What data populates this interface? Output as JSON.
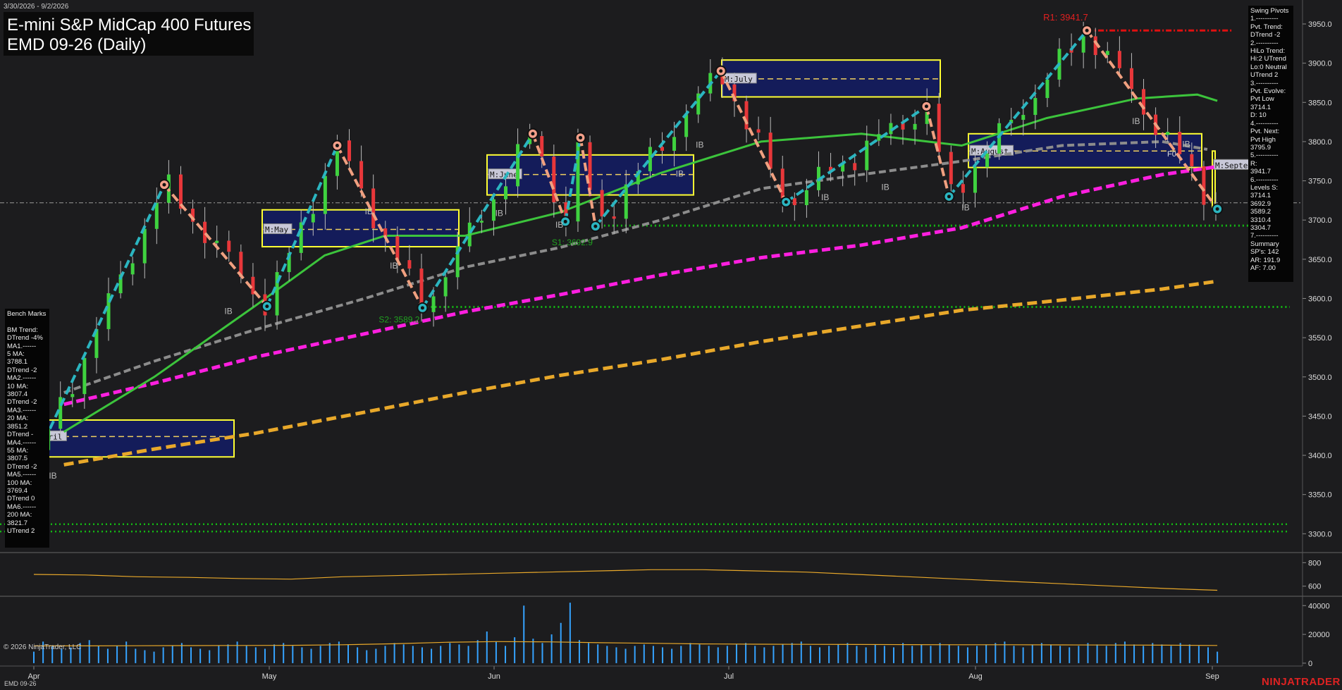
{
  "header": {
    "date_range": "3/30/2026 - 9/2/2026",
    "title": "E-mini S&P MidCap 400 Futures",
    "subtitle": "EMD 09-26 (Daily)"
  },
  "swing_pivots_panel": [
    "Swing Pivots",
    "1.----------",
    "Pvt. Trend:",
    "DTrend -2",
    "2.----------",
    "HiLo Trend:",
    "Hi:2 UTrend",
    "Lo:0 Neutral",
    "UTrend 2",
    "3.----------",
    "Pvt. Evolve:",
    "Pvt Low",
    "3714.1",
    "D: 10",
    "4.----------",
    "Pvt. Next:",
    "Pvt High",
    "3795.9",
    "5.----------",
    "R:",
    "3941.7",
    "6.----------",
    "Levels S:",
    "3714.1",
    "3692.9",
    "3589.2",
    "3310.4",
    "3304.7",
    "7.----------",
    "Summary",
    "SP's: 142",
    "AR: 191.9",
    "AF: 7.00"
  ],
  "bench_marks_panel": [
    "Bench Marks",
    "",
    "BM Trend:",
    "DTrend -4%",
    "MA1.------",
    "5 MA:",
    "3788.1",
    "DTrend -2",
    "MA2.------",
    "10 MA:",
    "3807.4",
    "DTrend -2",
    "MA3.------",
    "20 MA:",
    "3851.2",
    "DTrend -",
    "MA4.------",
    "55 MA:",
    "3807.5",
    "DTrend -2",
    "MA5.------",
    "100 MA:",
    "3769.4",
    "DTrend 0",
    "MA6.------",
    "200 MA:",
    "3821.7",
    "UTrend 2"
  ],
  "annotations": {
    "r1": "R1: 3941.7",
    "s1": "S1: 3692.9",
    "s2": "S2: 3589.2",
    "fo": "F0",
    "ib": "IB"
  },
  "month_boxes": [
    "M:April",
    "M:May",
    "M:June",
    "M:July",
    "M:August",
    "M:September"
  ],
  "copyright": "© 2026 NinjaTrader, LLC",
  "symbol_bottom": "EMD 09-26",
  "brand": "NINJATRADER",
  "colors": {
    "background": "#1c1c1e",
    "up_candle": "#3fd23f",
    "down_candle": "#e8373a",
    "magenta_ma": "#ff1fe0",
    "gold_ma": "#e8a82a",
    "green_ma": "#3cc43c",
    "gray_ma": "#8c8c8c",
    "swing_up": "#2bb5c0",
    "swing_down": "#f0a080",
    "month_box_fill": "#141c5a",
    "month_box_border": "#ffff33",
    "resistance": "#e01010",
    "support_dots": "#13b813",
    "volume_bars": "#35a3ff",
    "volume_ma": "#e8a82a",
    "indicator_line": "#e8a82a"
  },
  "chart_data": [
    {
      "type": "candlestick",
      "title": "EMD 09-26 (Daily)",
      "x_tick_labels": [
        "Apr",
        "May",
        "Jun",
        "Jul",
        "Aug",
        "Sep"
      ],
      "y_tick_labels": [
        "3950.0",
        "3900.0",
        "3850.0",
        "3800.0",
        "3750.0",
        "3700.0",
        "3650.0",
        "3600.0",
        "3550.0",
        "3500.0",
        "3450.0",
        "3400.0",
        "3350.0",
        "3300.0"
      ],
      "ylim": [
        3278,
        3972
      ],
      "current_price_line": 3722,
      "resistance_levels": [
        3941.7
      ],
      "support_levels": [
        3692.9,
        3589.2,
        3310.4,
        3304.7
      ],
      "month_boxes": [
        {
          "label": "M:April",
          "start": "Apr",
          "end": "May",
          "high": 3445,
          "low": 3398,
          "mid": 3424
        },
        {
          "label": "M:May",
          "start": "May",
          "end": "Jun",
          "high": 3713,
          "low": 3666,
          "mid": 3688
        },
        {
          "label": "M:June",
          "start": "Jun",
          "end": "Jul",
          "high": 3783,
          "low": 3732,
          "mid": 3758
        },
        {
          "label": "M:July",
          "start": "Jul",
          "end": "Aug",
          "high": 3904,
          "low": 3857,
          "mid": 3880
        },
        {
          "label": "M:August",
          "start": "Aug",
          "end": "Sep",
          "high": 3810,
          "low": 3767,
          "mid": 3788
        },
        {
          "label": "M:September",
          "start": "Sep",
          "end": "Sep",
          "high": 3788,
          "low": 3716,
          "mid": 3770
        }
      ],
      "swing_pivots": [
        {
          "x": 0.0,
          "price": 3390,
          "kind": "low"
        },
        {
          "x": 2.6,
          "price": 3745,
          "kind": "high"
        },
        {
          "x": 4.65,
          "price": 3590,
          "kind": "low"
        },
        {
          "x": 6.05,
          "price": 3795,
          "kind": "high"
        },
        {
          "x": 7.75,
          "price": 3588,
          "kind": "low"
        },
        {
          "x": 9.95,
          "price": 3810,
          "kind": "high"
        },
        {
          "x": 10.6,
          "price": 3698,
          "kind": "low"
        },
        {
          "x": 10.9,
          "price": 3805,
          "kind": "high"
        },
        {
          "x": 11.2,
          "price": 3692,
          "kind": "low"
        },
        {
          "x": 13.7,
          "price": 3890,
          "kind": "high"
        },
        {
          "x": 15.0,
          "price": 3723,
          "kind": "low"
        },
        {
          "x": 17.8,
          "price": 3845,
          "kind": "high"
        },
        {
          "x": 18.25,
          "price": 3730,
          "kind": "low"
        },
        {
          "x": 21.0,
          "price": 3941.7,
          "kind": "high"
        },
        {
          "x": 23.6,
          "price": 3714.1,
          "kind": "low"
        }
      ],
      "moving_averages": {
        "green": [
          [
            0.6,
            3430
          ],
          [
            2.4,
            3500
          ],
          [
            4.4,
            3590
          ],
          [
            5.8,
            3655
          ],
          [
            7.0,
            3680
          ],
          [
            8.6,
            3680
          ],
          [
            10.5,
            3710
          ],
          [
            12.5,
            3760
          ],
          [
            14.5,
            3800
          ],
          [
            16.5,
            3810
          ],
          [
            18.5,
            3795
          ],
          [
            20.2,
            3830
          ],
          [
            22.0,
            3855
          ],
          [
            23.2,
            3860
          ],
          [
            23.6,
            3852
          ]
        ],
        "gray": [
          [
            0.6,
            3480
          ],
          [
            2.4,
            3520
          ],
          [
            4.4,
            3560
          ],
          [
            6.6,
            3600
          ],
          [
            8.6,
            3640
          ],
          [
            10.5,
            3665
          ],
          [
            12.5,
            3700
          ],
          [
            14.5,
            3740
          ],
          [
            16.5,
            3758
          ],
          [
            18.5,
            3775
          ],
          [
            20.5,
            3795
          ],
          [
            22.5,
            3800
          ],
          [
            23.4,
            3790
          ]
        ],
        "magenta": [
          [
            0.6,
            3465
          ],
          [
            2.4,
            3492
          ],
          [
            4.4,
            3525
          ],
          [
            6.6,
            3555
          ],
          [
            8.6,
            3583
          ],
          [
            10.5,
            3605
          ],
          [
            12.5,
            3630
          ],
          [
            14.5,
            3652
          ],
          [
            16.5,
            3668
          ],
          [
            18.5,
            3690
          ],
          [
            20.5,
            3730
          ],
          [
            22.5,
            3758
          ],
          [
            23.6,
            3768
          ]
        ],
        "gold": [
          [
            0.6,
            3388
          ],
          [
            2.4,
            3408
          ],
          [
            4.4,
            3428
          ],
          [
            6.6,
            3455
          ],
          [
            8.6,
            3480
          ],
          [
            10.5,
            3502
          ],
          [
            12.5,
            3522
          ],
          [
            14.5,
            3545
          ],
          [
            16.5,
            3565
          ],
          [
            18.5,
            3585
          ],
          [
            20.5,
            3598
          ],
          [
            22.5,
            3612
          ],
          [
            23.6,
            3622
          ]
        ]
      }
    },
    {
      "type": "line",
      "title": "",
      "y_tick_labels": [
        "800",
        "600"
      ],
      "ylim": [
        520,
        880
      ],
      "series": [
        {
          "values": [
            700,
            695,
            680,
            675,
            665,
            660,
            680,
            690,
            700,
            710,
            720,
            730,
            740,
            740,
            730,
            720,
            700,
            680,
            660,
            640,
            620,
            600,
            580,
            565
          ]
        }
      ]
    },
    {
      "type": "bar",
      "title": "",
      "y_tick_labels": [
        "40000",
        "20000",
        "0"
      ],
      "ylim": [
        -2000,
        46000
      ],
      "values": [
        8000,
        15000,
        12000,
        10000,
        11000,
        14000,
        16000,
        12000,
        10000,
        12000,
        15000,
        10000,
        9000,
        8000,
        11000,
        12000,
        14000,
        11000,
        10000,
        9000,
        12000,
        13000,
        15000,
        12000,
        11000,
        10000,
        13000,
        14000,
        12000,
        11000,
        10000,
        12000,
        14000,
        15000,
        13000,
        11000,
        9000,
        10000,
        12000,
        14000,
        13000,
        12000,
        11000,
        10000,
        12000,
        14000,
        13000,
        12000,
        16000,
        22000,
        15000,
        12000,
        18000,
        40000,
        17000,
        14000,
        20000,
        28000,
        42000,
        16000,
        14000,
        13000,
        12000,
        11000,
        10000,
        12000,
        13000,
        12000,
        11000,
        10000,
        12000,
        14000,
        13000,
        12000,
        11000,
        12000,
        13000,
        14000,
        12000,
        11000,
        12000,
        13000,
        14000,
        15000,
        12000,
        11000,
        12000,
        13000,
        14000,
        12000,
        11000,
        13000,
        12000,
        11000,
        14000,
        12000,
        13000,
        12000,
        14000,
        13000,
        12000,
        11000,
        12000,
        13000,
        14000,
        15000,
        12000,
        11000,
        13000,
        14000,
        13000,
        12000,
        11000,
        12000,
        14000,
        13000,
        12000,
        14000,
        15000,
        13000,
        12000,
        14000,
        13000,
        12000,
        14000,
        13000,
        12000,
        11000,
        8000
      ],
      "ma_values": [
        12000,
        12000,
        12100,
        12200,
        12300,
        12400,
        12800,
        13500,
        14500,
        15000,
        14800,
        14200,
        13800,
        13400,
        13200,
        13100,
        13000,
        12900,
        12800,
        12800,
        12700,
        12600,
        12500,
        12300
      ]
    }
  ]
}
